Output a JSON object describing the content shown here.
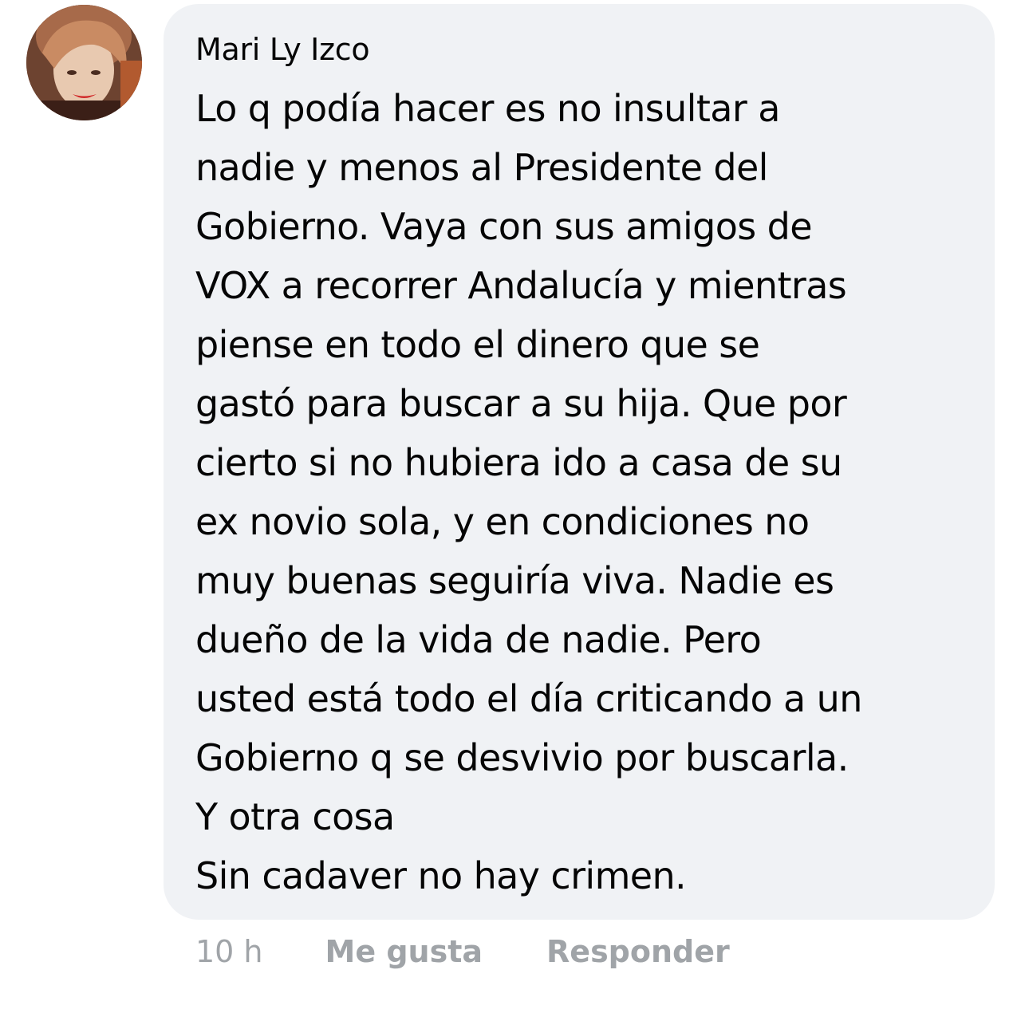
{
  "comment": {
    "author": "Mari Ly Izco",
    "avatar_icon": "profile-photo",
    "lines": [
      "Lo q podía hacer es no insultar a",
      "nadie y menos al Presidente del",
      "Gobierno. Vaya con sus amigos de",
      "VOX a recorrer Andalucía y mientras",
      "piense en todo el dinero que se",
      "gastó para buscar a su hija. Que por",
      "cierto si no hubiera ido a casa de su",
      "ex novio sola, y en condiciones no",
      "muy buenas seguiría viva. Nadie es",
      "dueño de la vida de nadie. Pero",
      "usted está todo el día criticando a un",
      "Gobierno q se desvivio por buscarla.",
      "Y otra cosa",
      "Sin cadaver no hay crimen."
    ],
    "bubble_color": "#f0f2f5",
    "text_color": "#050505"
  },
  "actions": {
    "timestamp": "10 h",
    "like_label": "Me gusta",
    "reply_label": "Responder",
    "color": "#a0a4a8"
  }
}
